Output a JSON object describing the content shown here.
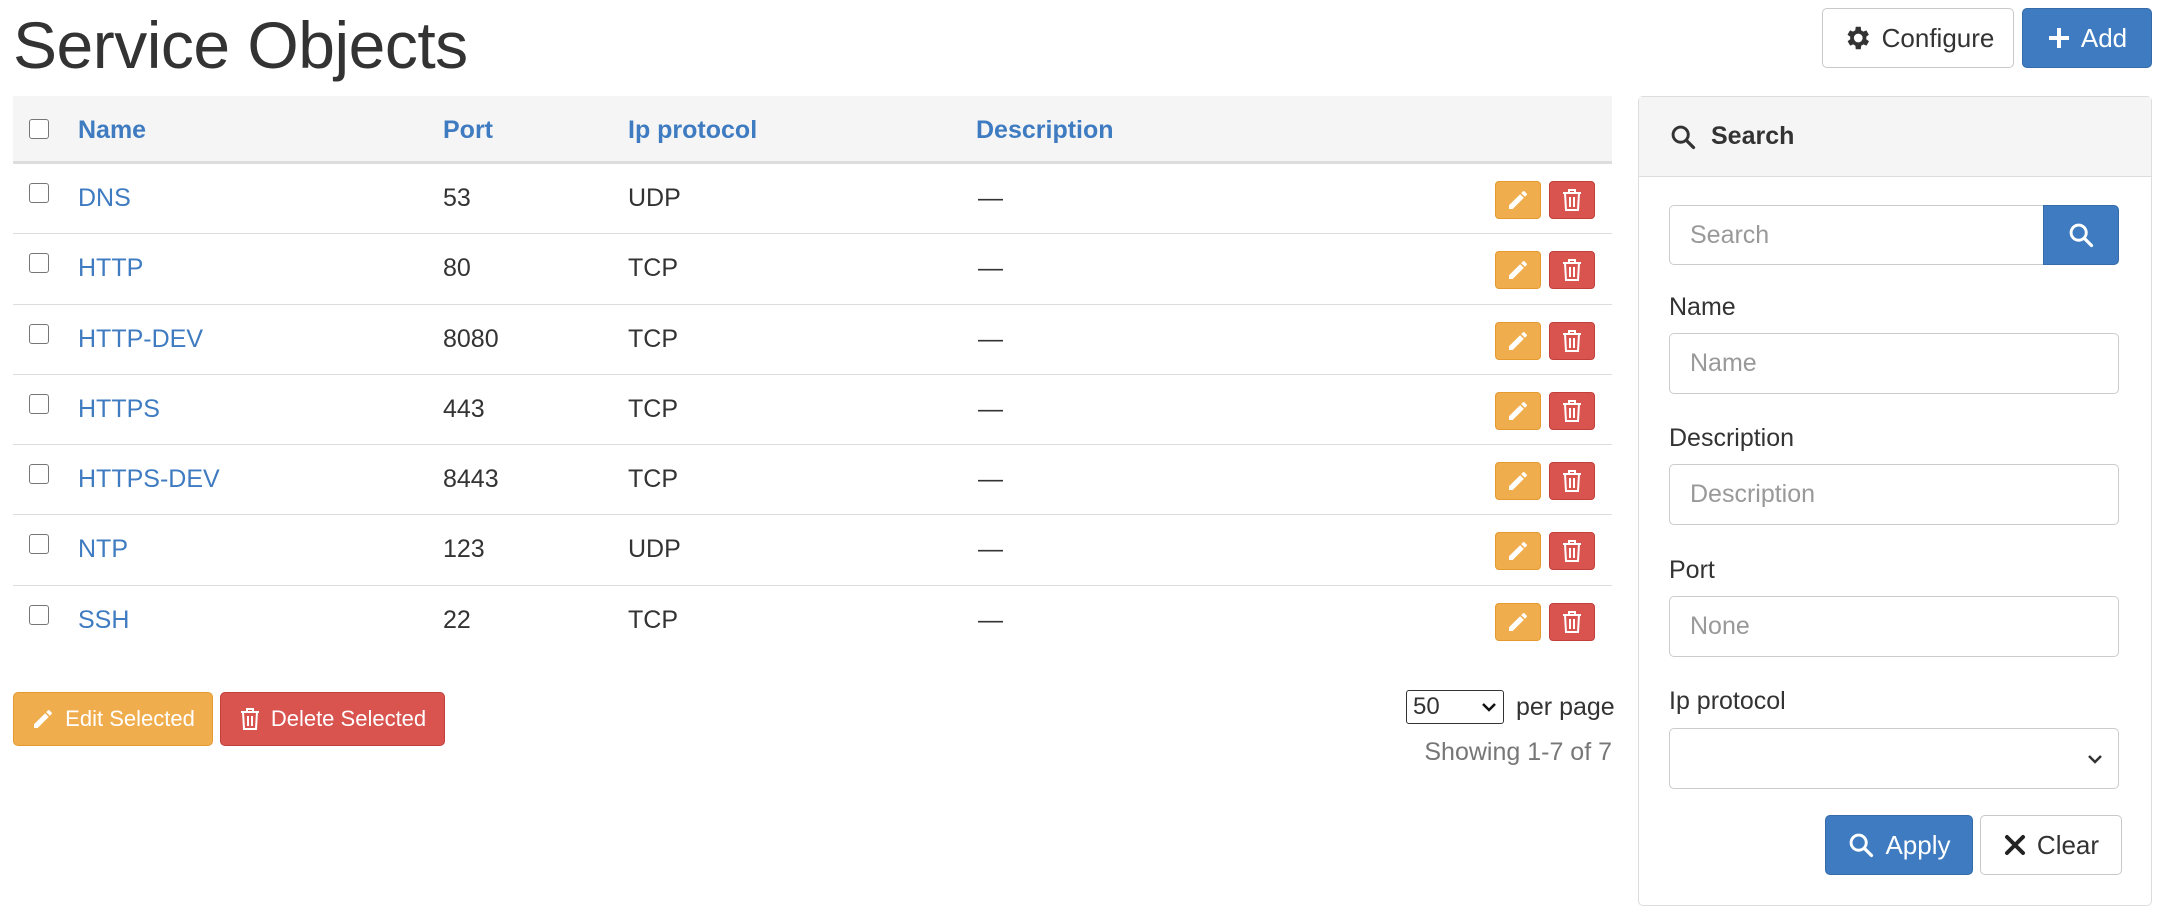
{
  "page": {
    "title": "Service Objects"
  },
  "toolbar": {
    "configure_label": "Configure",
    "add_label": "Add"
  },
  "table": {
    "headers": {
      "name": "Name",
      "port": "Port",
      "protocol": "Ip protocol",
      "description": "Description"
    },
    "rows": [
      {
        "name": "DNS",
        "port": "53",
        "protocol": "UDP",
        "description": "—"
      },
      {
        "name": "HTTP",
        "port": "80",
        "protocol": "TCP",
        "description": "—"
      },
      {
        "name": "HTTP-DEV",
        "port": "8080",
        "protocol": "TCP",
        "description": "—"
      },
      {
        "name": "HTTPS",
        "port": "443",
        "protocol": "TCP",
        "description": "—"
      },
      {
        "name": "HTTPS-DEV",
        "port": "8443",
        "protocol": "TCP",
        "description": "—"
      },
      {
        "name": "NTP",
        "port": "123",
        "protocol": "UDP",
        "description": "—"
      },
      {
        "name": "SSH",
        "port": "22",
        "protocol": "TCP",
        "description": "—"
      }
    ]
  },
  "bulk": {
    "edit_label": "Edit Selected",
    "delete_label": "Delete Selected"
  },
  "pagination": {
    "per_page_value": "50",
    "per_page_label": "per page",
    "showing": "Showing 1-7 of 7"
  },
  "search_panel": {
    "title": "Search",
    "search_placeholder": "Search",
    "fields": {
      "name": {
        "label": "Name",
        "placeholder": "Name"
      },
      "description": {
        "label": "Description",
        "placeholder": "Description"
      },
      "port": {
        "label": "Port",
        "placeholder": "None"
      },
      "protocol": {
        "label": "Ip protocol",
        "value": ""
      }
    },
    "apply_label": "Apply",
    "clear_label": "Clear"
  },
  "colors": {
    "primary": "#3e7bc0",
    "warning": "#f0ad4e",
    "danger": "#d9534f"
  }
}
